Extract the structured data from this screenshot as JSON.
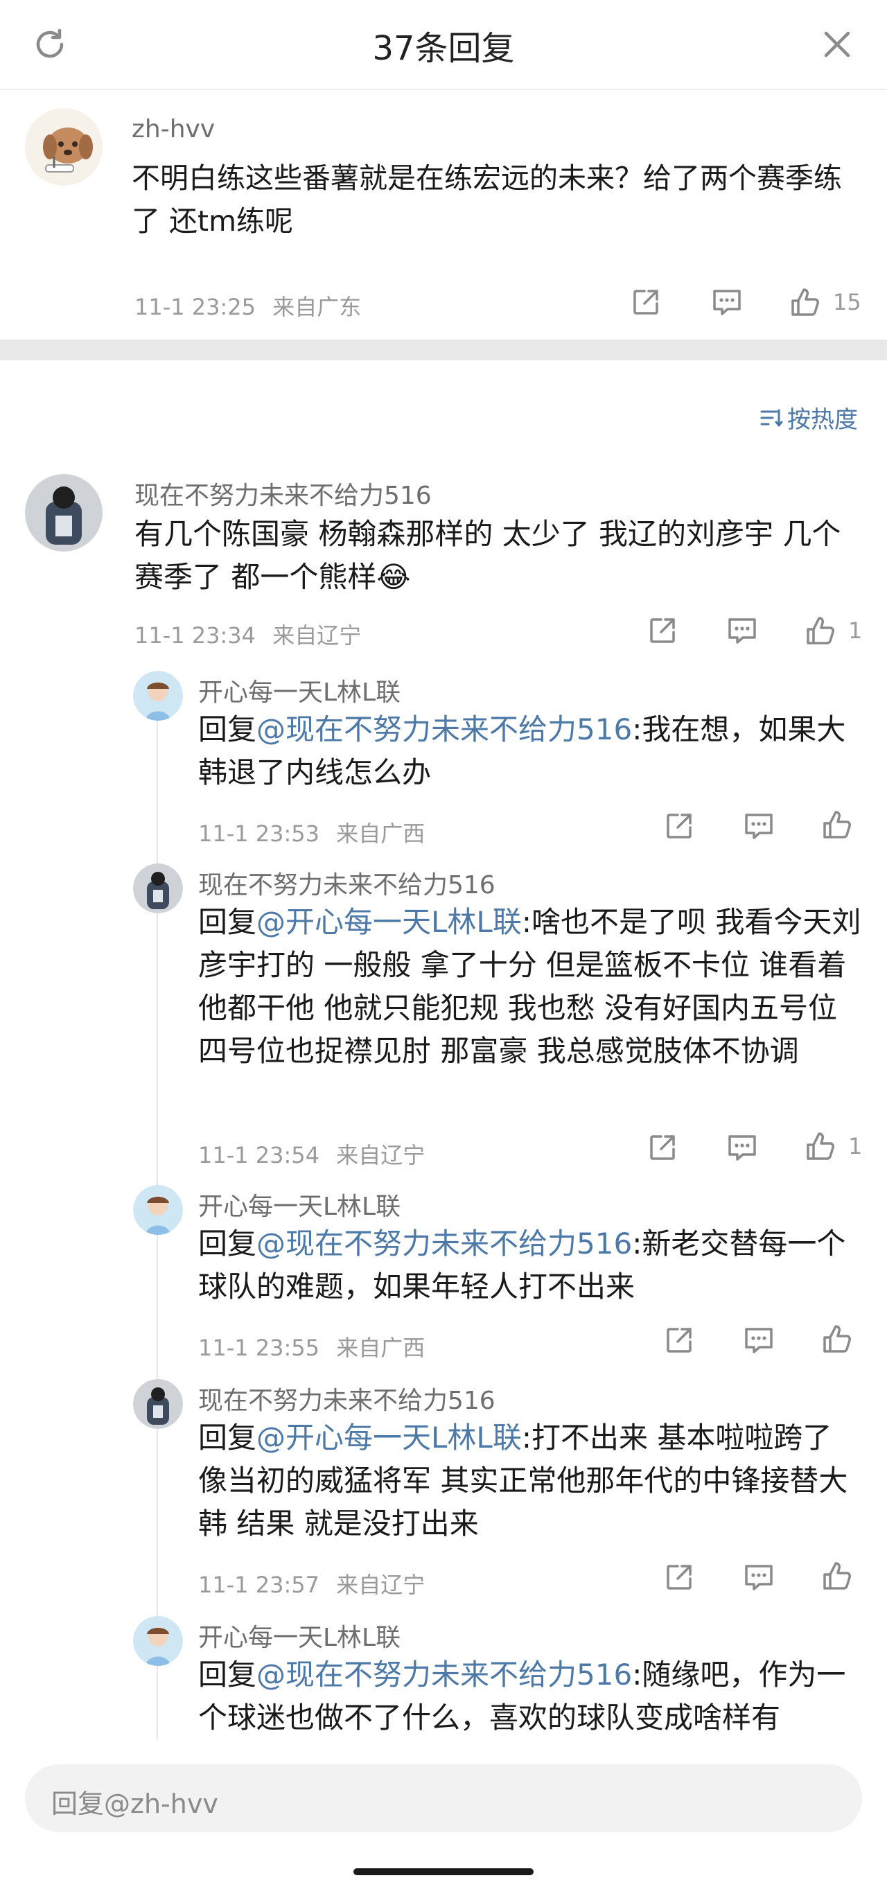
{
  "header": {
    "title": "37条回复",
    "refresh_icon": "refresh-icon",
    "close_icon": "close-icon"
  },
  "main_comment": {
    "username": "zh-hvv",
    "text": "不明白练这些番薯就是在练宏远的未来？给了两个赛季练了 还tm练呢",
    "time": "11-1 23:25",
    "location": "来自广东",
    "likes": "15"
  },
  "sort_label": "按热度",
  "comments": [
    {
      "username": "现在不努力未来不给力516",
      "text": "有几个陈国豪 杨翰森那样的 太少了 我辽的刘彦宇 几个赛季了 都一个熊样",
      "emoji": "😂",
      "time": "11-1 23:34",
      "location": "来自辽宁",
      "likes": "1"
    }
  ],
  "replies": [
    {
      "username": "开心每一天L林L联",
      "prefix": "回复",
      "mention": "@现在不努力未来不给力516",
      "text": ":我在想，如果大韩退了内线怎么办",
      "time": "11-1 23:53",
      "location": "来自广西",
      "likes": ""
    },
    {
      "username": "现在不努力未来不给力516",
      "prefix": "回复",
      "mention": "@开心每一天L林L联",
      "text": ":啥也不是了呗 我看今天刘彦宇打的 一般般 拿了十分 但是篮板不卡位 谁看着他都干他 他就只能犯规 我也愁 没有好国内五号位 四号位也捉襟见肘 那富豪 我总感觉肢体不协调",
      "time": "11-1 23:54",
      "location": "来自辽宁",
      "likes": "1"
    },
    {
      "username": "开心每一天L林L联",
      "prefix": "回复",
      "mention": "@现在不努力未来不给力516",
      "text": ":新老交替每一个球队的难题，如果年轻人打不出来",
      "time": "11-1 23:55",
      "location": "来自广西",
      "likes": ""
    },
    {
      "username": "现在不努力未来不给力516",
      "prefix": "回复",
      "mention": "@开心每一天L林L联",
      "text": ":打不出来 基本啦啦跨了 像当初的威猛将军 其实正常他那年代的中锋接替大韩 结果 就是没打出来",
      "time": "11-1 23:57",
      "location": "来自辽宁",
      "likes": ""
    },
    {
      "username": "开心每一天L林L联",
      "prefix": "回复",
      "mention": "@现在不努力未来不给力516",
      "text": ":随缘吧，作为一个球迷也做不了什么，喜欢的球队变成啥样有",
      "time": "",
      "location": "",
      "likes": ""
    }
  ],
  "reply_input": {
    "placeholder": "回复@zh-hvv"
  },
  "colors": {
    "mention": "#4d79a8",
    "meta": "#9a9a9a",
    "divider": "#e8e8e8"
  }
}
